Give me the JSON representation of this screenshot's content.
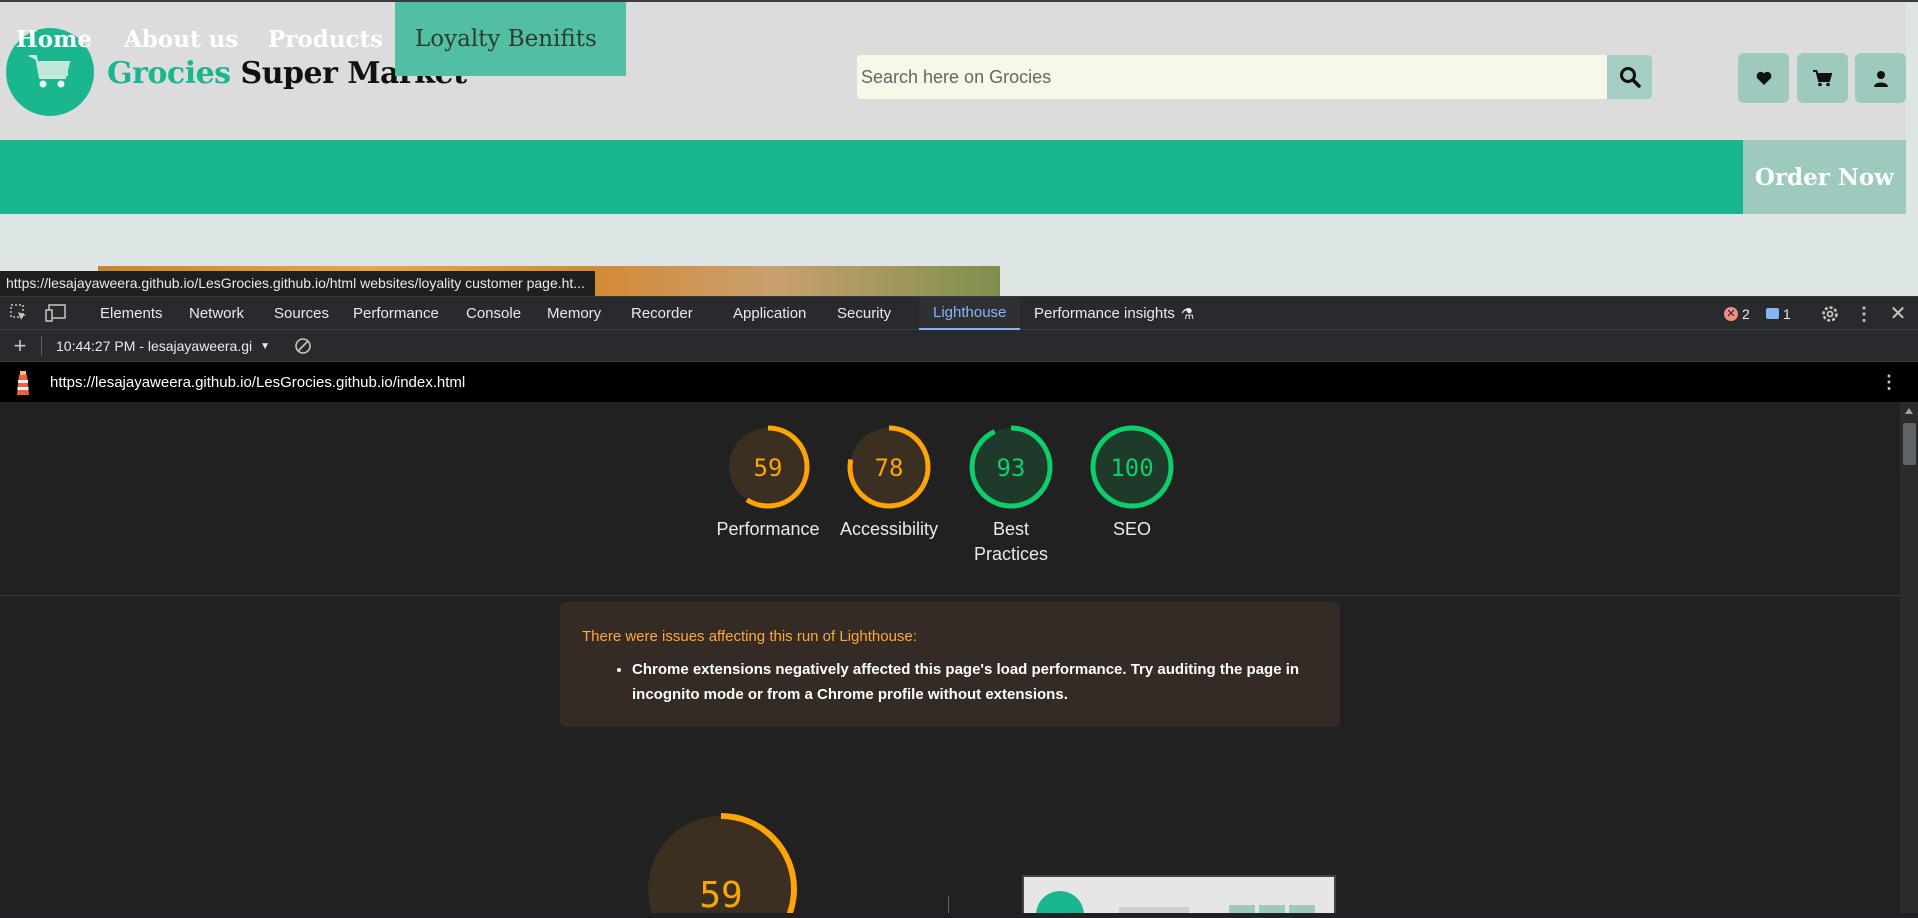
{
  "site": {
    "brand_green": "Grocies",
    "brand_dark": "Super Market",
    "search_placeholder": "Search here on Grocies",
    "nav": [
      "Home",
      "About us",
      "Products",
      "Loyalty Benifits"
    ],
    "order_button": "Order Now",
    "status_url": "https://lesajayaweera.github.io/LesGrocies.github.io/html websites/loyality customer page.ht...",
    "colors": {
      "accent": "#1ab690",
      "accent_muted": "#9ec9bf"
    }
  },
  "devtools": {
    "tabs": [
      "Elements",
      "Network",
      "Sources",
      "Performance",
      "Console",
      "Memory",
      "Recorder",
      "Application",
      "Security",
      "Lighthouse",
      "Performance insights"
    ],
    "active_tab": "Lighthouse",
    "error_count": "2",
    "message_count": "1",
    "report_selector": "10:44:27 PM - lesajayaweera.gi",
    "report_url": "https://lesajayaweera.github.io/LesGrocies.github.io/index.html"
  },
  "lighthouse": {
    "scores": [
      {
        "value": "59",
        "label": "Performance",
        "color": "#ffa400"
      },
      {
        "value": "78",
        "label": "Accessibility",
        "color": "#ffa400"
      },
      {
        "value": "93",
        "label": "Best Practices",
        "color": "#0cce6b"
      },
      {
        "value": "100",
        "label": "SEO",
        "color": "#0cce6b"
      }
    ],
    "warning_title": "There were issues affecting this run of Lighthouse:",
    "warning_item": "Chrome extensions negatively affected this page's load performance. Try auditing the page in incognito mode or from a Chrome profile without extensions.",
    "big_score": "59"
  }
}
